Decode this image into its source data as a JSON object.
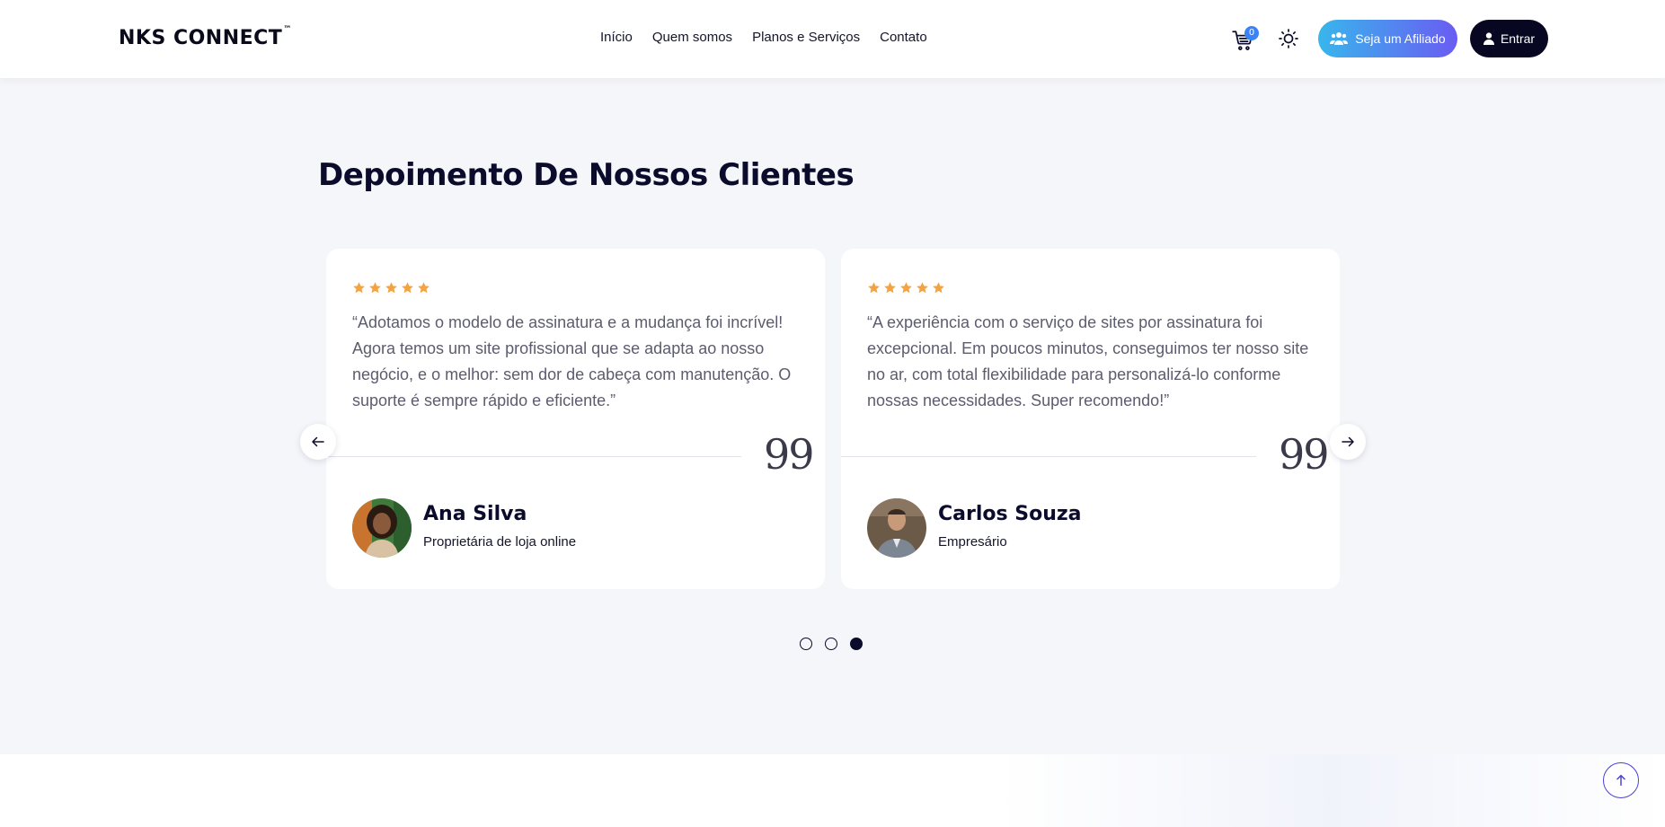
{
  "header": {
    "logo": "NKS CONNECT",
    "logo_tm": "™",
    "nav": [
      "Início",
      "Quem somos",
      "Planos e Serviços",
      "Contato"
    ],
    "cart_count": "0",
    "affiliate_label": "Seja um Afiliado",
    "login_label": "Entrar"
  },
  "section": {
    "title": "Depoimento De Nossos Clientes"
  },
  "testimonials": [
    {
      "rating": 5,
      "text": "“Adotamos o modelo de assinatura e a mudança foi incrível! Agora temos um site profissional que se adapta ao nosso negócio, e o melhor: sem dor de cabeça com manutenção. O suporte é sempre rápido e eficiente.”",
      "quote_mark": "99",
      "name": "Ana Silva",
      "role": "Proprietária de loja online"
    },
    {
      "rating": 5,
      "text": "“A experiência com o serviço de sites por assinatura foi excepcional. Em poucos minutos, conseguimos ter nosso site no ar, com total flexibilidade para personalizá-lo conforme nossas necessidades. Super recomendo!”",
      "quote_mark": "99",
      "name": "Carlos Souza",
      "role": "Empresário"
    }
  ],
  "carousel": {
    "pages": 3,
    "active_page": 3
  },
  "colors": {
    "star": "#f4a340",
    "accent_blue": "#38b6ec",
    "accent_purple": "#6a5cf3",
    "dark": "#070722",
    "badge": "#3b82f6"
  },
  "icons": {
    "cart": "cart-icon",
    "theme": "sun-icon",
    "affiliate": "users-icon",
    "login": "user-icon",
    "prev": "arrow-left-icon",
    "next": "arrow-right-icon",
    "scroll_top": "arrow-up-icon"
  }
}
